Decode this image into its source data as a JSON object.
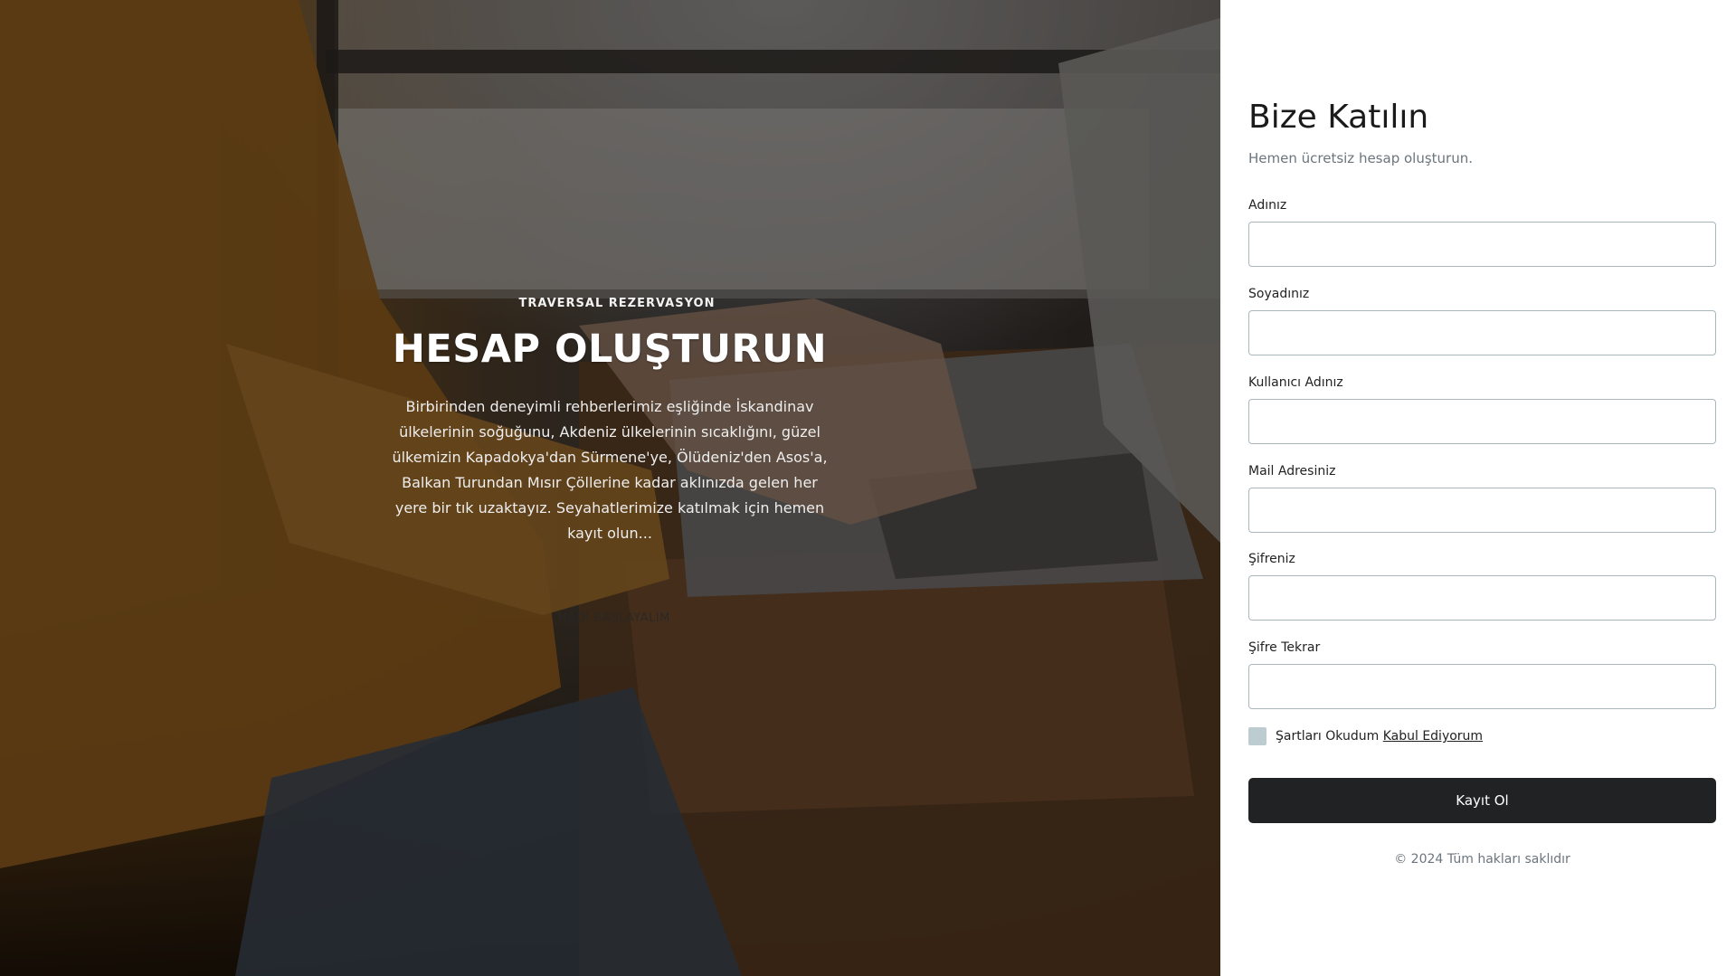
{
  "hero": {
    "kicker": "TRAVERSAL REZERVASYON",
    "title": "HESAP OLUŞTURUN",
    "description": "Birbirinden deneyimli rehberlerimiz eşliğinde İskandinav ülkelerinin soğuğunu, Akdeniz ülkelerinin sıcaklığını, güzel ülkemizin Kapadokya'dan Sürmene'ye, Ölüdeniz'den Asos'a, Balkan Turundan Mısır Çöllerine kadar aklınızda gelen her yere bir tık uzaktayız. Seyahatlerimize katılmak için hemen kayıt olun...",
    "cta": "HADİ BAŞLAYALIM"
  },
  "form": {
    "title": "Bize Katılın",
    "subtitle": "Hemen ücretsiz hesap oluşturun.",
    "fields": [
      {
        "label": "Adınız",
        "value": ""
      },
      {
        "label": "Soyadınız",
        "value": ""
      },
      {
        "label": "Kullanıcı Adınız",
        "value": ""
      },
      {
        "label": "Mail Adresiniz",
        "value": ""
      },
      {
        "label": "Şifreniz",
        "value": ""
      },
      {
        "label": "Şifre Tekrar",
        "value": ""
      }
    ],
    "terms_text": "Şartları Okudum",
    "terms_link": "Kabul Ediyorum",
    "terms_checked": false,
    "submit_label": "Kayıt Ol",
    "footer": "© 2024 Tüm hakları saklıdır"
  },
  "colors": {
    "button_bg": "#212223",
    "input_border": "#a9b7bd",
    "checkbox_bg": "#bcccd1",
    "muted_text": "#6c757d"
  }
}
